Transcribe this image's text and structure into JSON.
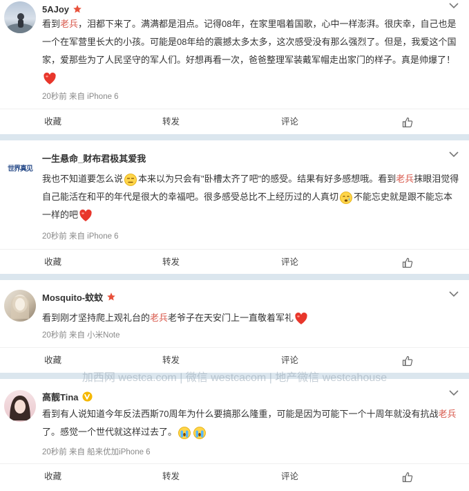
{
  "posts": [
    {
      "name": "5AJoy",
      "badge": "star",
      "text": [
        {
          "t": "看到"
        },
        {
          "t": "老兵",
          "hl": true
        },
        {
          "t": "，泪都下来了。满满都是泪点。记得08年，在家里唱着国歌，心中一样澎湃。很庆幸，自己也是一个在军营里长大的小孩。可能是08年给的震撼太多太多，这次感受没有那么强烈了。但是，我爱这个国家，爱那些为了人民坚守的军人们。好想再看一次，爸爸整理军装戴军帽走出家门的样子。真是帅爆了！"
        },
        {
          "emoji": "heart"
        }
      ],
      "meta": "20秒前 来自 iPhone 6",
      "actions": [
        "收藏",
        "转发",
        "评论"
      ]
    },
    {
      "name": "一生悬命_财布君极其爱我",
      "badge": "",
      "avatar_text": "世界真见",
      "text": [
        {
          "t": "我也不知道要怎么说"
        },
        {
          "emoji": "sigh"
        },
        {
          "t": "本来以为只会有\"卧槽太齐了吧\"的感受。结果有好多感想哦。看到"
        },
        {
          "t": "老兵",
          "hl": true
        },
        {
          "t": "抹眼泪觉得自己能活在和平的年代是很大的幸福吧。很多感受总比不上经历过的人真切"
        },
        {
          "emoji": "cry"
        },
        {
          "t": "不能忘史就是跟不能忘本一样的吧"
        },
        {
          "emoji": "heart"
        }
      ],
      "meta": "20秒前 来自 iPhone 6",
      "actions": [
        "收藏",
        "转发",
        "评论"
      ]
    },
    {
      "name": "Mosquito-蚊蚊",
      "badge": "star",
      "text": [
        {
          "t": "看到刚才坚持爬上观礼台的"
        },
        {
          "t": "老兵",
          "hl": true
        },
        {
          "t": "老爷子在天安门上一直敬着军礼"
        },
        {
          "emoji": "heart"
        }
      ],
      "meta": "20秒前 来自 小米Note",
      "actions": [
        "收藏",
        "转发",
        "评论"
      ]
    },
    {
      "name": "高靓Tina",
      "badge": "v",
      "text": [
        {
          "t": "看到有人说知道今年反法西斯70周年为什么要搞那么隆重，可能是因为可能下一个十周年就没有抗战"
        },
        {
          "t": "老兵",
          "hl": true
        },
        {
          "t": "了。感觉一个世代就这样过去了。"
        },
        {
          "emoji": "tears"
        },
        {
          "emoji": "tears"
        }
      ],
      "meta": "20秒前 来自 船来优加iPhone 6",
      "actions": [
        "收藏",
        "转发",
        "评论"
      ]
    }
  ],
  "watermark": "加西网 westca.com | 微信 westcacom | 地产微信 westcahouse",
  "colors": {
    "highlight": "#d8584b",
    "separator": "#dbe6ee",
    "badge_star": "#e8503a",
    "badge_v": "#f5b800"
  }
}
